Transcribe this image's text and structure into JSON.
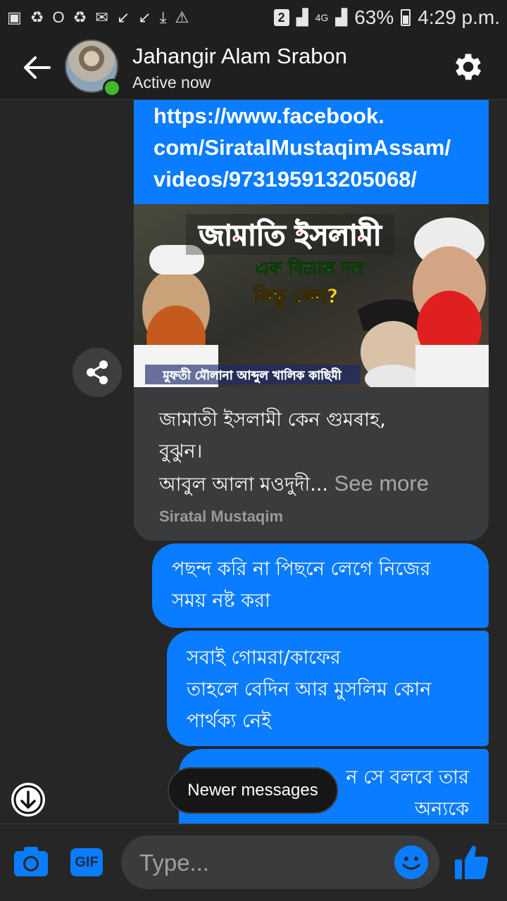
{
  "status_bar": {
    "notification_icons": [
      "gallery-icon",
      "recycle-icon",
      "opera-icon",
      "recycle-icon",
      "mail-icon",
      "missed-call-icon",
      "missed-call-icon",
      "download-icon",
      "warning-icon"
    ],
    "sim_badge": "2",
    "network": "4G",
    "battery": "63%",
    "time": "4:29 p.m."
  },
  "header": {
    "contact_name": "Jahangir Alam Srabon",
    "status": "Active now"
  },
  "link_card": {
    "url_lines": [
      "https://www.facebook.",
      "com/SiratalMustaqimAssam/",
      "videos/973195913205068/"
    ],
    "thumbnail": {
      "headline": "জামাতি ইসলামী",
      "subline": "এক বিভ্রান্ত দল",
      "question": "কিন্তু কেন?",
      "caption": "মুফতী মৌলানা আব্দুল খালিক কাছিমী"
    },
    "description_lines": [
      "জামাতী ইসলামী কেন গুমৰাহ,",
      "বুঝুন।"
    ],
    "description_last": "আবুল আলা মওদুদী...",
    "see_more": "See more",
    "source": "Siratal Mustaqim"
  },
  "messages": [
    {
      "lines": [
        "পছন্দ করি না পিছনে লেগে নিজের",
        "সময় নষ্ট করা"
      ]
    },
    {
      "lines": [
        "সবাই গোমরা/কাফের",
        "তাহলে বেদিন আর মুসলিম কোন",
        "পার্থক্য নেই"
      ]
    },
    {
      "lines": [
        "ন সে বলবে তার",
        "অন্যকে"
      ]
    }
  ],
  "overlay": {
    "newer_messages": "Newer messages"
  },
  "composer": {
    "gif_label": "GIF",
    "placeholder": "Type..."
  },
  "colors": {
    "accent": "#0a7cff",
    "background": "#262626",
    "card": "#3a3b3c",
    "presence": "#42b72a"
  }
}
